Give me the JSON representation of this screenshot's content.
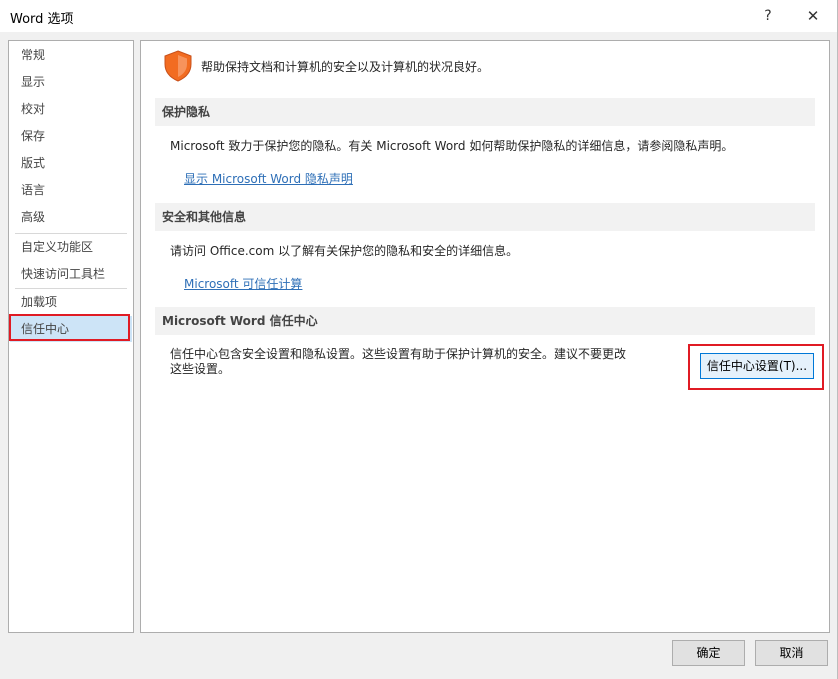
{
  "window": {
    "title": "Word 选项",
    "help_label": "?",
    "close_label": "✕"
  },
  "sidebar": {
    "items": [
      {
        "label": "常规",
        "active": false
      },
      {
        "label": "显示",
        "active": false
      },
      {
        "label": "校对",
        "active": false
      },
      {
        "label": "保存",
        "active": false
      },
      {
        "label": "版式",
        "active": false
      },
      {
        "label": "语言",
        "active": false
      },
      {
        "label": "高级",
        "active": false
      },
      {
        "label": "自定义功能区",
        "active": false
      },
      {
        "label": "快速访问工具栏",
        "active": false
      },
      {
        "label": "加载项",
        "active": false
      },
      {
        "label": "信任中心",
        "active": true
      }
    ]
  },
  "main": {
    "header_icon": "shield-icon",
    "header_text": "帮助保持文档和计算机的安全以及计算机的状况良好。",
    "privacy": {
      "heading": "保护隐私",
      "text": "Microsoft 致力于保护您的隐私。有关 Microsoft Word 如何帮助保护隐私的详细信息，请参阅隐私声明。",
      "link": "显示 Microsoft Word 隐私声明"
    },
    "security": {
      "heading": "安全和其他信息",
      "text": "请访问 Office.com 以了解有关保护您的隐私和安全的详细信息。",
      "link": "Microsoft 可信任计算"
    },
    "trust_center": {
      "heading": "Microsoft Word 信任中心",
      "text_line1": "信任中心包含安全设置和隐私设置。这些设置有助于保护计算机的安全。建议不要更改",
      "text_line2": "这些设置。",
      "button_label": "信任中心设置(T)..."
    }
  },
  "footer": {
    "ok_label": "确定",
    "cancel_label": "取消"
  },
  "colors": {
    "accent_highlight": "#e01b24",
    "link": "#2e6fb7",
    "selected_nav": "#cde4f7",
    "shield": "#f26c21"
  }
}
